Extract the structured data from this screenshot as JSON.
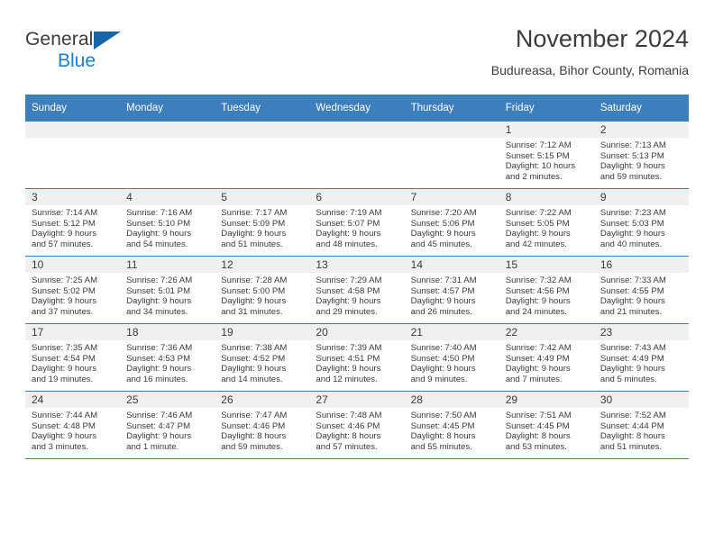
{
  "brand": {
    "line1": "General",
    "line2": "Blue",
    "triangle_color": "#1565a8",
    "blue_text_color": "#1b7fd4"
  },
  "header": {
    "title": "November 2024",
    "subtitle": "Budureasa, Bihor County, Romania"
  },
  "theme": {
    "header_blue": "#3d7ebd",
    "daynum_bg": "#f0f0f0",
    "text": "#3a3a3a"
  },
  "calendar": {
    "weekday_headers": [
      "Sunday",
      "Monday",
      "Tuesday",
      "Wednesday",
      "Thursday",
      "Friday",
      "Saturday"
    ],
    "weeks": [
      [
        {
          "day": "",
          "blank": true,
          "lines": []
        },
        {
          "day": "",
          "blank": true,
          "lines": []
        },
        {
          "day": "",
          "blank": true,
          "lines": []
        },
        {
          "day": "",
          "blank": true,
          "lines": []
        },
        {
          "day": "",
          "blank": true,
          "lines": []
        },
        {
          "day": "1",
          "blank": false,
          "lines": [
            "Sunrise: 7:12 AM",
            "Sunset: 5:15 PM",
            "Daylight: 10 hours",
            "and 2 minutes."
          ]
        },
        {
          "day": "2",
          "blank": false,
          "lines": [
            "Sunrise: 7:13 AM",
            "Sunset: 5:13 PM",
            "Daylight: 9 hours",
            "and 59 minutes."
          ]
        }
      ],
      [
        {
          "day": "3",
          "blank": false,
          "lines": [
            "Sunrise: 7:14 AM",
            "Sunset: 5:12 PM",
            "Daylight: 9 hours",
            "and 57 minutes."
          ]
        },
        {
          "day": "4",
          "blank": false,
          "lines": [
            "Sunrise: 7:16 AM",
            "Sunset: 5:10 PM",
            "Daylight: 9 hours",
            "and 54 minutes."
          ]
        },
        {
          "day": "5",
          "blank": false,
          "lines": [
            "Sunrise: 7:17 AM",
            "Sunset: 5:09 PM",
            "Daylight: 9 hours",
            "and 51 minutes."
          ]
        },
        {
          "day": "6",
          "blank": false,
          "lines": [
            "Sunrise: 7:19 AM",
            "Sunset: 5:07 PM",
            "Daylight: 9 hours",
            "and 48 minutes."
          ]
        },
        {
          "day": "7",
          "blank": false,
          "lines": [
            "Sunrise: 7:20 AM",
            "Sunset: 5:06 PM",
            "Daylight: 9 hours",
            "and 45 minutes."
          ]
        },
        {
          "day": "8",
          "blank": false,
          "lines": [
            "Sunrise: 7:22 AM",
            "Sunset: 5:05 PM",
            "Daylight: 9 hours",
            "and 42 minutes."
          ]
        },
        {
          "day": "9",
          "blank": false,
          "lines": [
            "Sunrise: 7:23 AM",
            "Sunset: 5:03 PM",
            "Daylight: 9 hours",
            "and 40 minutes."
          ]
        }
      ],
      [
        {
          "day": "10",
          "blank": false,
          "lines": [
            "Sunrise: 7:25 AM",
            "Sunset: 5:02 PM",
            "Daylight: 9 hours",
            "and 37 minutes."
          ]
        },
        {
          "day": "11",
          "blank": false,
          "lines": [
            "Sunrise: 7:26 AM",
            "Sunset: 5:01 PM",
            "Daylight: 9 hours",
            "and 34 minutes."
          ]
        },
        {
          "day": "12",
          "blank": false,
          "lines": [
            "Sunrise: 7:28 AM",
            "Sunset: 5:00 PM",
            "Daylight: 9 hours",
            "and 31 minutes."
          ]
        },
        {
          "day": "13",
          "blank": false,
          "lines": [
            "Sunrise: 7:29 AM",
            "Sunset: 4:58 PM",
            "Daylight: 9 hours",
            "and 29 minutes."
          ]
        },
        {
          "day": "14",
          "blank": false,
          "lines": [
            "Sunrise: 7:31 AM",
            "Sunset: 4:57 PM",
            "Daylight: 9 hours",
            "and 26 minutes."
          ]
        },
        {
          "day": "15",
          "blank": false,
          "lines": [
            "Sunrise: 7:32 AM",
            "Sunset: 4:56 PM",
            "Daylight: 9 hours",
            "and 24 minutes."
          ]
        },
        {
          "day": "16",
          "blank": false,
          "lines": [
            "Sunrise: 7:33 AM",
            "Sunset: 4:55 PM",
            "Daylight: 9 hours",
            "and 21 minutes."
          ]
        }
      ],
      [
        {
          "day": "17",
          "blank": false,
          "lines": [
            "Sunrise: 7:35 AM",
            "Sunset: 4:54 PM",
            "Daylight: 9 hours",
            "and 19 minutes."
          ]
        },
        {
          "day": "18",
          "blank": false,
          "lines": [
            "Sunrise: 7:36 AM",
            "Sunset: 4:53 PM",
            "Daylight: 9 hours",
            "and 16 minutes."
          ]
        },
        {
          "day": "19",
          "blank": false,
          "lines": [
            "Sunrise: 7:38 AM",
            "Sunset: 4:52 PM",
            "Daylight: 9 hours",
            "and 14 minutes."
          ]
        },
        {
          "day": "20",
          "blank": false,
          "lines": [
            "Sunrise: 7:39 AM",
            "Sunset: 4:51 PM",
            "Daylight: 9 hours",
            "and 12 minutes."
          ]
        },
        {
          "day": "21",
          "blank": false,
          "lines": [
            "Sunrise: 7:40 AM",
            "Sunset: 4:50 PM",
            "Daylight: 9 hours",
            "and 9 minutes."
          ]
        },
        {
          "day": "22",
          "blank": false,
          "lines": [
            "Sunrise: 7:42 AM",
            "Sunset: 4:49 PM",
            "Daylight: 9 hours",
            "and 7 minutes."
          ]
        },
        {
          "day": "23",
          "blank": false,
          "lines": [
            "Sunrise: 7:43 AM",
            "Sunset: 4:49 PM",
            "Daylight: 9 hours",
            "and 5 minutes."
          ]
        }
      ],
      [
        {
          "day": "24",
          "blank": false,
          "lines": [
            "Sunrise: 7:44 AM",
            "Sunset: 4:48 PM",
            "Daylight: 9 hours",
            "and 3 minutes."
          ]
        },
        {
          "day": "25",
          "blank": false,
          "lines": [
            "Sunrise: 7:46 AM",
            "Sunset: 4:47 PM",
            "Daylight: 9 hours",
            "and 1 minute."
          ]
        },
        {
          "day": "26",
          "blank": false,
          "lines": [
            "Sunrise: 7:47 AM",
            "Sunset: 4:46 PM",
            "Daylight: 8 hours",
            "and 59 minutes."
          ]
        },
        {
          "day": "27",
          "blank": false,
          "lines": [
            "Sunrise: 7:48 AM",
            "Sunset: 4:46 PM",
            "Daylight: 8 hours",
            "and 57 minutes."
          ]
        },
        {
          "day": "28",
          "blank": false,
          "lines": [
            "Sunrise: 7:50 AM",
            "Sunset: 4:45 PM",
            "Daylight: 8 hours",
            "and 55 minutes."
          ]
        },
        {
          "day": "29",
          "blank": false,
          "lines": [
            "Sunrise: 7:51 AM",
            "Sunset: 4:45 PM",
            "Daylight: 8 hours",
            "and 53 minutes."
          ]
        },
        {
          "day": "30",
          "blank": false,
          "lines": [
            "Sunrise: 7:52 AM",
            "Sunset: 4:44 PM",
            "Daylight: 8 hours",
            "and 51 minutes."
          ]
        }
      ]
    ]
  }
}
